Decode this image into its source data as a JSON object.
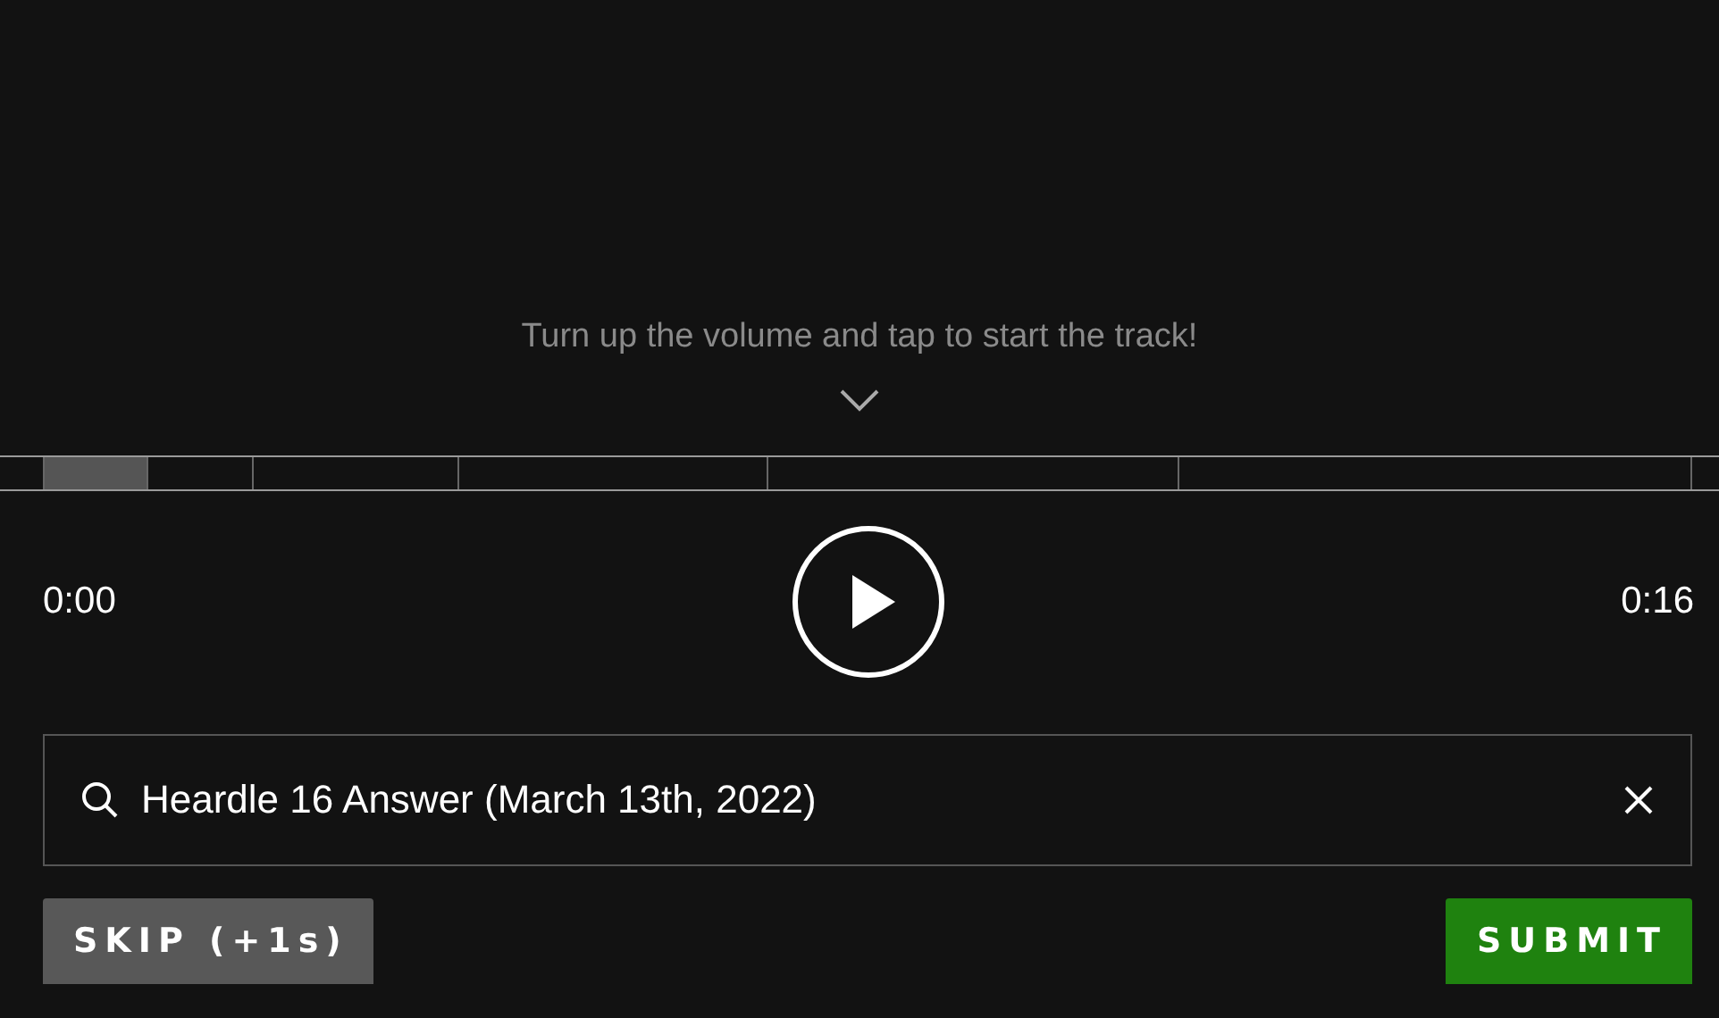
{
  "hint": {
    "text": "Turn up the volume and tap to start the track!"
  },
  "segments": [
    {
      "unlocked": true
    },
    {
      "unlocked": false
    },
    {
      "unlocked": false
    },
    {
      "unlocked": false
    },
    {
      "unlocked": false
    },
    {
      "unlocked": false
    }
  ],
  "player": {
    "elapsed": "0:00",
    "duration": "0:16",
    "playing": false
  },
  "search": {
    "value": "Heardle 16 Answer (March 13th, 2022)"
  },
  "buttons": [
    {
      "kind": "skip",
      "label": "SKIP (+1s)"
    },
    {
      "kind": "submit",
      "label": "SUBMIT"
    }
  ]
}
